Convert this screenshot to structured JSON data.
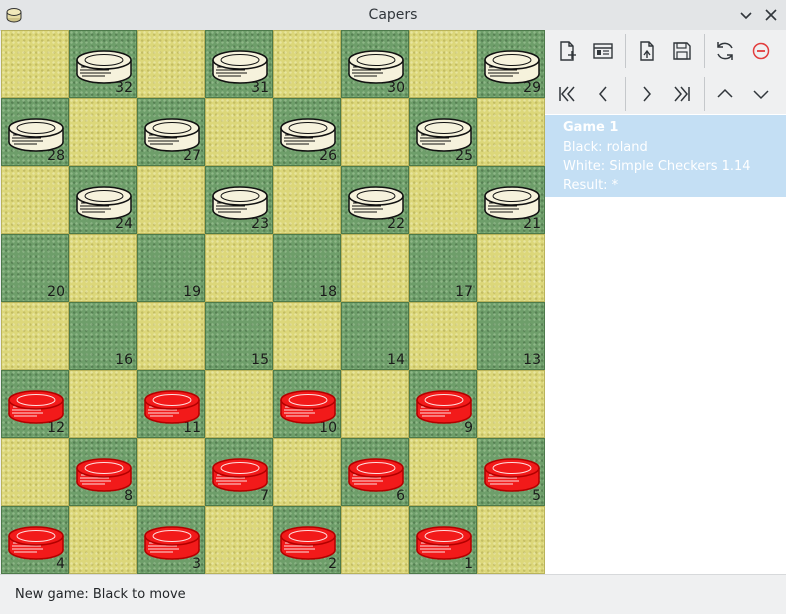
{
  "window": {
    "title": "Capers"
  },
  "colors": {
    "light_square": "#dcd77a",
    "dark_square": "#6e9e6a",
    "white_piece": "#f6f2dc",
    "red_piece": "#f21a1a",
    "selection": "#c4dff4"
  },
  "board": {
    "rows": [
      {
        "squares": [
          {
            "num": "",
            "piece": "none"
          },
          {
            "num": "32",
            "piece": "white"
          },
          {
            "num": "",
            "piece": "none"
          },
          {
            "num": "31",
            "piece": "white"
          },
          {
            "num": "",
            "piece": "none"
          },
          {
            "num": "30",
            "piece": "white"
          },
          {
            "num": "",
            "piece": "none"
          },
          {
            "num": "29",
            "piece": "white"
          }
        ]
      },
      {
        "squares": [
          {
            "num": "28",
            "piece": "white"
          },
          {
            "num": "",
            "piece": "none"
          },
          {
            "num": "27",
            "piece": "white"
          },
          {
            "num": "",
            "piece": "none"
          },
          {
            "num": "26",
            "piece": "white"
          },
          {
            "num": "",
            "piece": "none"
          },
          {
            "num": "25",
            "piece": "white"
          },
          {
            "num": "",
            "piece": "none"
          }
        ]
      },
      {
        "squares": [
          {
            "num": "",
            "piece": "none"
          },
          {
            "num": "24",
            "piece": "white"
          },
          {
            "num": "",
            "piece": "none"
          },
          {
            "num": "23",
            "piece": "white"
          },
          {
            "num": "",
            "piece": "none"
          },
          {
            "num": "22",
            "piece": "white"
          },
          {
            "num": "",
            "piece": "none"
          },
          {
            "num": "21",
            "piece": "white"
          }
        ]
      },
      {
        "squares": [
          {
            "num": "20",
            "piece": "none"
          },
          {
            "num": "",
            "piece": "none"
          },
          {
            "num": "19",
            "piece": "none"
          },
          {
            "num": "",
            "piece": "none"
          },
          {
            "num": "18",
            "piece": "none"
          },
          {
            "num": "",
            "piece": "none"
          },
          {
            "num": "17",
            "piece": "none"
          },
          {
            "num": "",
            "piece": "none"
          }
        ]
      },
      {
        "squares": [
          {
            "num": "",
            "piece": "none"
          },
          {
            "num": "16",
            "piece": "none"
          },
          {
            "num": "",
            "piece": "none"
          },
          {
            "num": "15",
            "piece": "none"
          },
          {
            "num": "",
            "piece": "none"
          },
          {
            "num": "14",
            "piece": "none"
          },
          {
            "num": "",
            "piece": "none"
          },
          {
            "num": "13",
            "piece": "none"
          }
        ]
      },
      {
        "squares": [
          {
            "num": "12",
            "piece": "red"
          },
          {
            "num": "",
            "piece": "none"
          },
          {
            "num": "11",
            "piece": "red"
          },
          {
            "num": "",
            "piece": "none"
          },
          {
            "num": "10",
            "piece": "red"
          },
          {
            "num": "",
            "piece": "none"
          },
          {
            "num": "9",
            "piece": "red"
          },
          {
            "num": "",
            "piece": "none"
          }
        ]
      },
      {
        "squares": [
          {
            "num": "",
            "piece": "none"
          },
          {
            "num": "8",
            "piece": "red"
          },
          {
            "num": "",
            "piece": "none"
          },
          {
            "num": "7",
            "piece": "red"
          },
          {
            "num": "",
            "piece": "none"
          },
          {
            "num": "6",
            "piece": "red"
          },
          {
            "num": "",
            "piece": "none"
          },
          {
            "num": "5",
            "piece": "red"
          }
        ]
      },
      {
        "squares": [
          {
            "num": "4",
            "piece": "red"
          },
          {
            "num": "",
            "piece": "none"
          },
          {
            "num": "3",
            "piece": "red"
          },
          {
            "num": "",
            "piece": "none"
          },
          {
            "num": "2",
            "piece": "red"
          },
          {
            "num": "",
            "piece": "none"
          },
          {
            "num": "1",
            "piece": "red"
          },
          {
            "num": "",
            "piece": "none"
          }
        ]
      }
    ]
  },
  "toolbar": {
    "row1": [
      "new-game-icon",
      "game-properties-icon",
      "open-game-icon",
      "save-icon",
      "reload-icon",
      "resign-icon"
    ],
    "row2": [
      "first-move-icon",
      "previous-move-icon",
      "next-move-icon",
      "last-move-icon",
      "previous-game-icon",
      "next-game-icon"
    ]
  },
  "game_list": {
    "items": [
      {
        "title": "Game 1",
        "black": "Black: roland",
        "white": "White: Simple Checkers 1.14",
        "result": "Result: *"
      }
    ]
  },
  "status": {
    "text": "New game: Black to move"
  }
}
